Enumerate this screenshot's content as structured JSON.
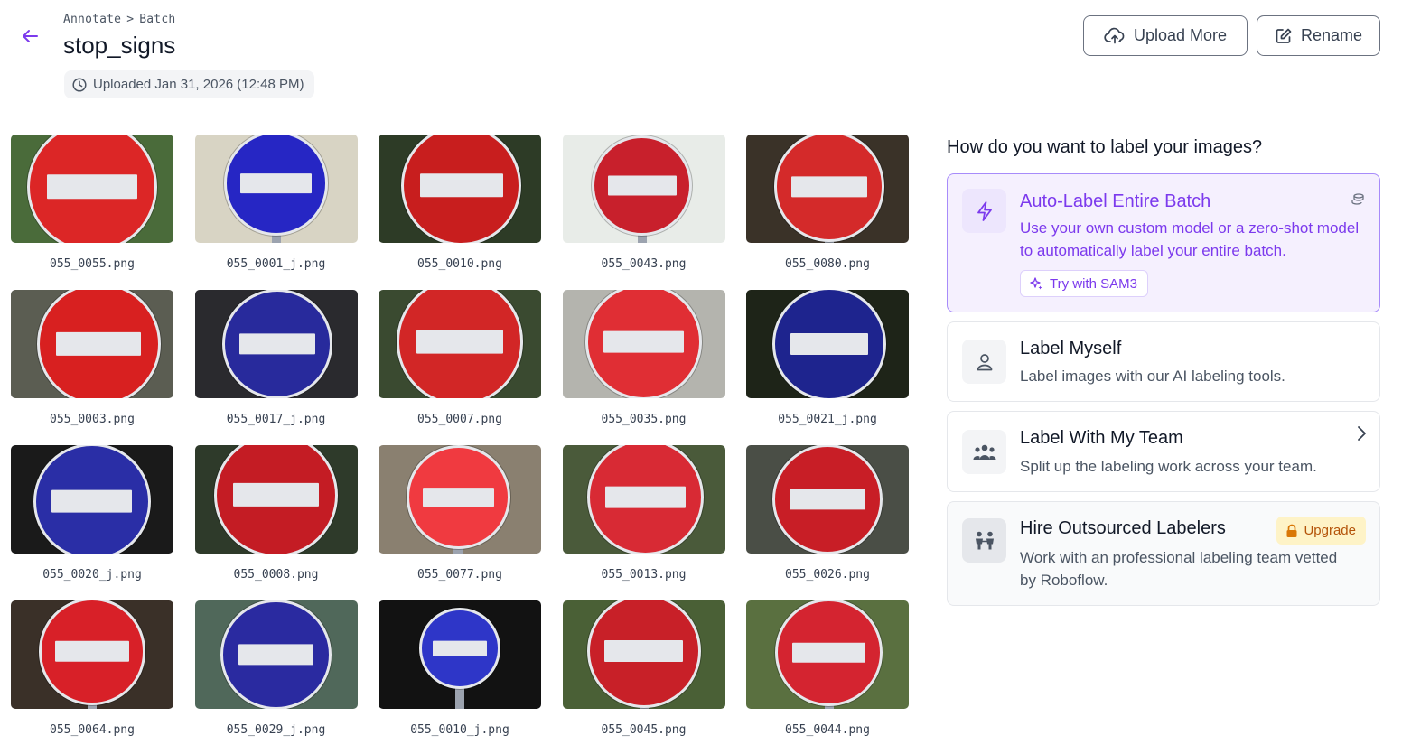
{
  "header": {
    "breadcrumb": [
      "Annotate",
      "Batch"
    ],
    "breadcrumb_sep": ">",
    "title": "stop_signs",
    "uploaded": "Uploaded Jan 31, 2026 (12:48 PM)",
    "upload_more_label": "Upload More",
    "rename_label": "Rename"
  },
  "images": [
    {
      "name": "055_0055.png",
      "sign": "#dc2626",
      "bg": "#4a6b3a"
    },
    {
      "name": "055_0001_j.png",
      "sign": "#2626c4",
      "bg": "#d8d4c4"
    },
    {
      "name": "055_0010.png",
      "sign": "#c81e1e",
      "bg": "#2d3b26"
    },
    {
      "name": "055_0043.png",
      "sign": "#c8202c",
      "bg": "#e8ece8"
    },
    {
      "name": "055_0080.png",
      "sign": "#d42a2a",
      "bg": "#3a3228"
    },
    {
      "name": "055_0003.png",
      "sign": "#d82020",
      "bg": "#5b5d52"
    },
    {
      "name": "055_0017_j.png",
      "sign": "#282a9c",
      "bg": "#2a2a2e"
    },
    {
      "name": "055_0007.png",
      "sign": "#d22626",
      "bg": "#3a4a30"
    },
    {
      "name": "055_0035.png",
      "sign": "#e02e34",
      "bg": "#b4b4ae"
    },
    {
      "name": "055_0021_j.png",
      "sign": "#1e248e",
      "bg": "#1e2418"
    },
    {
      "name": "055_0020_j.png",
      "sign": "#2a2ea6",
      "bg": "#1a1a1a"
    },
    {
      "name": "055_0008.png",
      "sign": "#c41c24",
      "bg": "#2e3a2a"
    },
    {
      "name": "055_0077.png",
      "sign": "#f03a40",
      "bg": "#8a8070"
    },
    {
      "name": "055_0013.png",
      "sign": "#d82a34",
      "bg": "#4a5a3a"
    },
    {
      "name": "055_0026.png",
      "sign": "#c81e26",
      "bg": "#4a4e46"
    },
    {
      "name": "055_0064.png",
      "sign": "#d82028",
      "bg": "#3a3028"
    },
    {
      "name": "055_0029_j.png",
      "sign": "#2a2aa0",
      "bg": "#50685a"
    },
    {
      "name": "055_0010_j.png",
      "sign": "#2e36c8",
      "bg": "#121212"
    },
    {
      "name": "055_0045.png",
      "sign": "#c82028",
      "bg": "#4a6036"
    },
    {
      "name": "055_0044.png",
      "sign": "#d42430",
      "bg": "#5a7040"
    }
  ],
  "panel": {
    "question": "How do you want to label your images?",
    "auto": {
      "title": "Auto-Label Entire Batch",
      "desc": "Use your own custom model or a zero-shot model to automatically label your entire batch.",
      "sam_label": "Try with SAM3",
      "icon": "lightning-icon"
    },
    "myself": {
      "title": "Label Myself",
      "desc": "Label images with our AI labeling tools.",
      "icon": "user-icon"
    },
    "team": {
      "title": "Label With My Team",
      "desc": "Split up the labeling work across your team.",
      "icon": "team-icon"
    },
    "hire": {
      "title": "Hire Outsourced Labelers",
      "desc": "Work with an professional labeling team vetted by Roboflow.",
      "badge": "Upgrade",
      "icon": "labelers-icon"
    }
  },
  "colors": {
    "accent": "#7c3aed",
    "accent_bg": "#f5f0fe",
    "upgrade_bg": "#fef3c7",
    "upgrade_text": "#b45309"
  }
}
